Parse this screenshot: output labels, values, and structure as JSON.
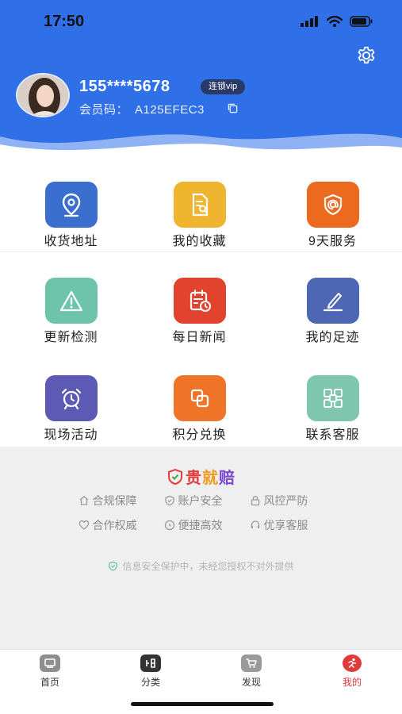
{
  "status": {
    "time": "17:50"
  },
  "profile": {
    "phone": "155****5678",
    "vip_badge": "连锁vip",
    "member_label": "会员码：",
    "member_code": "A125EFEC3"
  },
  "grid": [
    {
      "label": "收货地址",
      "icon": "location-pin-icon",
      "color": "#3a6fd0"
    },
    {
      "label": "我的收藏",
      "icon": "document-search-icon",
      "color": "#f0b52e"
    },
    {
      "label": "9天服务",
      "icon": "shield-at-icon",
      "color": "#ec6a1e"
    },
    {
      "label": "更新检测",
      "icon": "warning-triangle-icon",
      "color": "#6ec4ab"
    },
    {
      "label": "每日新闻",
      "icon": "calendar-clock-icon",
      "color": "#e2432f"
    },
    {
      "label": "我的足迹",
      "icon": "pen-sign-icon",
      "color": "#4d67b5"
    },
    {
      "label": "现场活动",
      "icon": "alarm-clock-icon",
      "color": "#5d5ab5"
    },
    {
      "label": "积分兑换",
      "icon": "exchange-squares-icon",
      "color": "#ef7428"
    },
    {
      "label": "联系客服",
      "icon": "grid-squares-icon",
      "color": "#7ec6ad"
    }
  ],
  "badge_title": {
    "p1": "贵",
    "p2": "就",
    "p3": "赔"
  },
  "features": [
    {
      "label": "合规保障",
      "icon": "house-shield-icon"
    },
    {
      "label": "账户安全",
      "icon": "shield-check-icon"
    },
    {
      "label": "风控严防",
      "icon": "lock-icon"
    },
    {
      "label": "合作权威",
      "icon": "heart-hands-icon"
    },
    {
      "label": "便捷高效",
      "icon": "lightning-icon"
    },
    {
      "label": "优享客服",
      "icon": "headset-icon"
    }
  ],
  "notice": "信息安全保护中，未经您授权不对外提供",
  "tabs": [
    {
      "label": "首页",
      "icon": "home-icon",
      "color": "#8e8e8e"
    },
    {
      "label": "分类",
      "icon": "category-icon",
      "color": "#333333"
    },
    {
      "label": "发现",
      "icon": "cart-icon",
      "color": "#9a9a9a"
    },
    {
      "label": "我的",
      "icon": "profile-run-icon",
      "color": "#e03a3a"
    }
  ],
  "colors": {
    "header": "#2f6fe8",
    "active": "#e03a3a"
  }
}
